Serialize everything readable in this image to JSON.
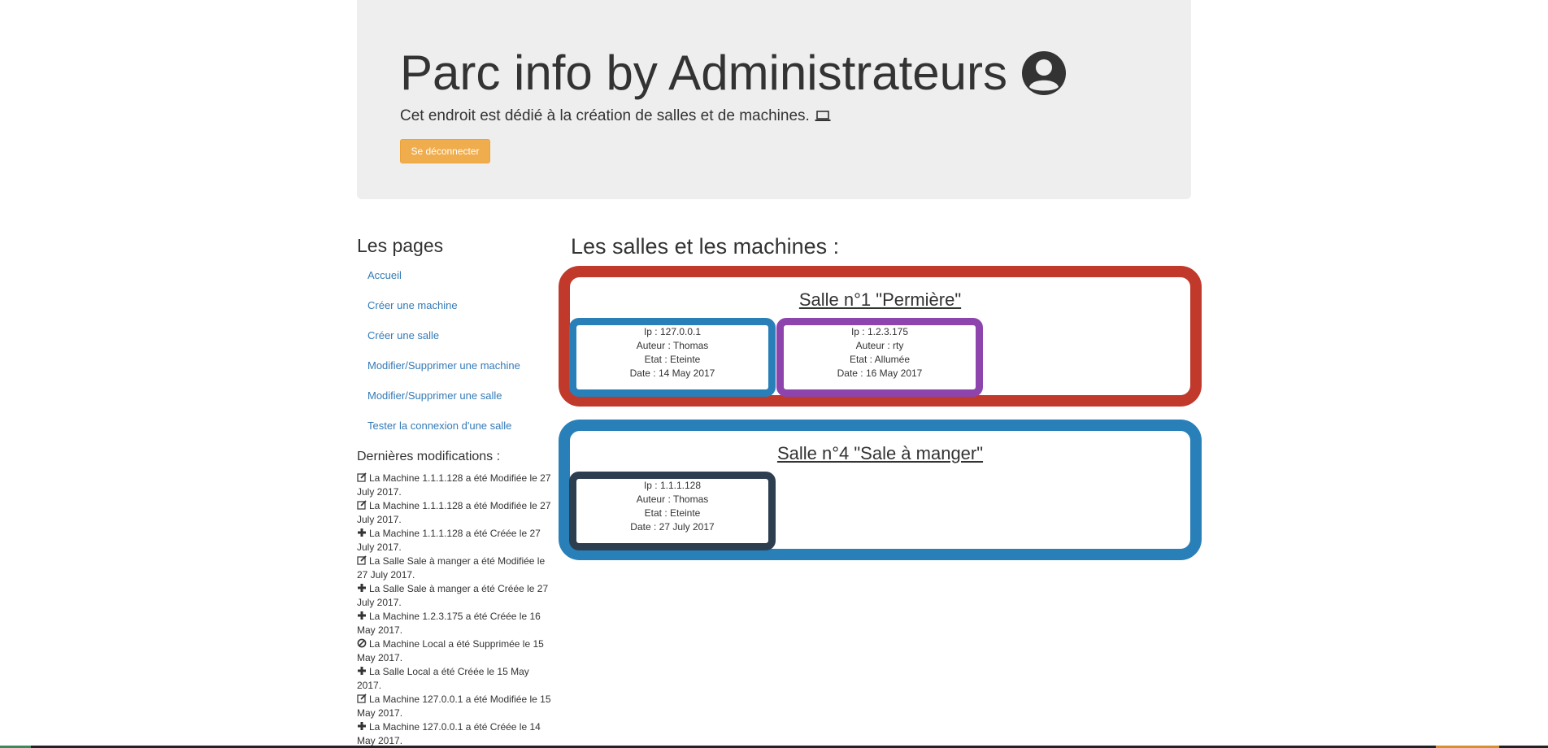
{
  "header": {
    "title": "Parc info by Administrateurs",
    "subtitle": "Cet endroit est dédié à la création de salles et de machines.",
    "logout_label": "Se déconnecter",
    "logout_color": "#f0ad4e"
  },
  "sidebar": {
    "title": "Les pages",
    "items": [
      {
        "label": "Accueil"
      },
      {
        "label": "Créer une machine"
      },
      {
        "label": "Créer une salle"
      },
      {
        "label": "Modifier/Supprimer une machine"
      },
      {
        "label": "Modifier/Supprimer une salle"
      },
      {
        "label": "Tester la connexion d'une salle"
      }
    ],
    "mods_title": "Dernières modifications :",
    "mods": [
      {
        "icon": "edit-icon",
        "text": "La Machine 1.1.1.128 a été Modifiée le 27 July 2017."
      },
      {
        "icon": "edit-icon",
        "text": "La Machine 1.1.1.128 a été Modifiée le 27 July 2017."
      },
      {
        "icon": "plus-icon",
        "text": "La Machine 1.1.1.128 a été Créée le 27 July 2017."
      },
      {
        "icon": "edit-icon",
        "text": "La Salle Sale à manger a été Modifiée le 27 July 2017."
      },
      {
        "icon": "plus-icon",
        "text": "La Salle Sale à manger a été Créée le 27 July 2017."
      },
      {
        "icon": "plus-icon",
        "text": "La Machine 1.2.3.175 a été Créée le 16 May 2017."
      },
      {
        "icon": "ban-icon",
        "text": "La Machine Local a été Supprimée le 15 May 2017."
      },
      {
        "icon": "plus-icon",
        "text": "La Salle Local a été Créée le 15 May 2017."
      },
      {
        "icon": "edit-icon",
        "text": "La Machine 127.0.0.1 a été Modifiée le 15 May 2017."
      },
      {
        "icon": "plus-icon",
        "text": "La Machine 127.0.0.1 a été Créée le 14 May 2017."
      }
    ]
  },
  "main": {
    "title": "Les salles et les machines :",
    "salles": [
      {
        "title": "Salle n°1 \"Permière\"",
        "color": "#c0392b",
        "machines": [
          {
            "ip": "Ip : 127.0.0.1",
            "auteur": "Auteur : Thomas",
            "etat": "Etat : Eteinte",
            "date": "Date : 14 May 2017",
            "color": "#2980b9"
          },
          {
            "ip": "Ip : 1.2.3.175",
            "auteur": "Auteur : rty",
            "etat": "Etat : Allumée",
            "date": "Date : 16 May 2017",
            "color": "#8e44ad"
          }
        ]
      },
      {
        "title": "Salle n°4 \"Sale à manger\"",
        "color": "#2980b9",
        "machines": [
          {
            "ip": "Ip : 1.1.1.128",
            "auteur": "Auteur : Thomas",
            "etat": "Etat : Eteinte",
            "date": "Date : 27 July 2017",
            "color": "#2c3e50"
          }
        ]
      }
    ]
  }
}
